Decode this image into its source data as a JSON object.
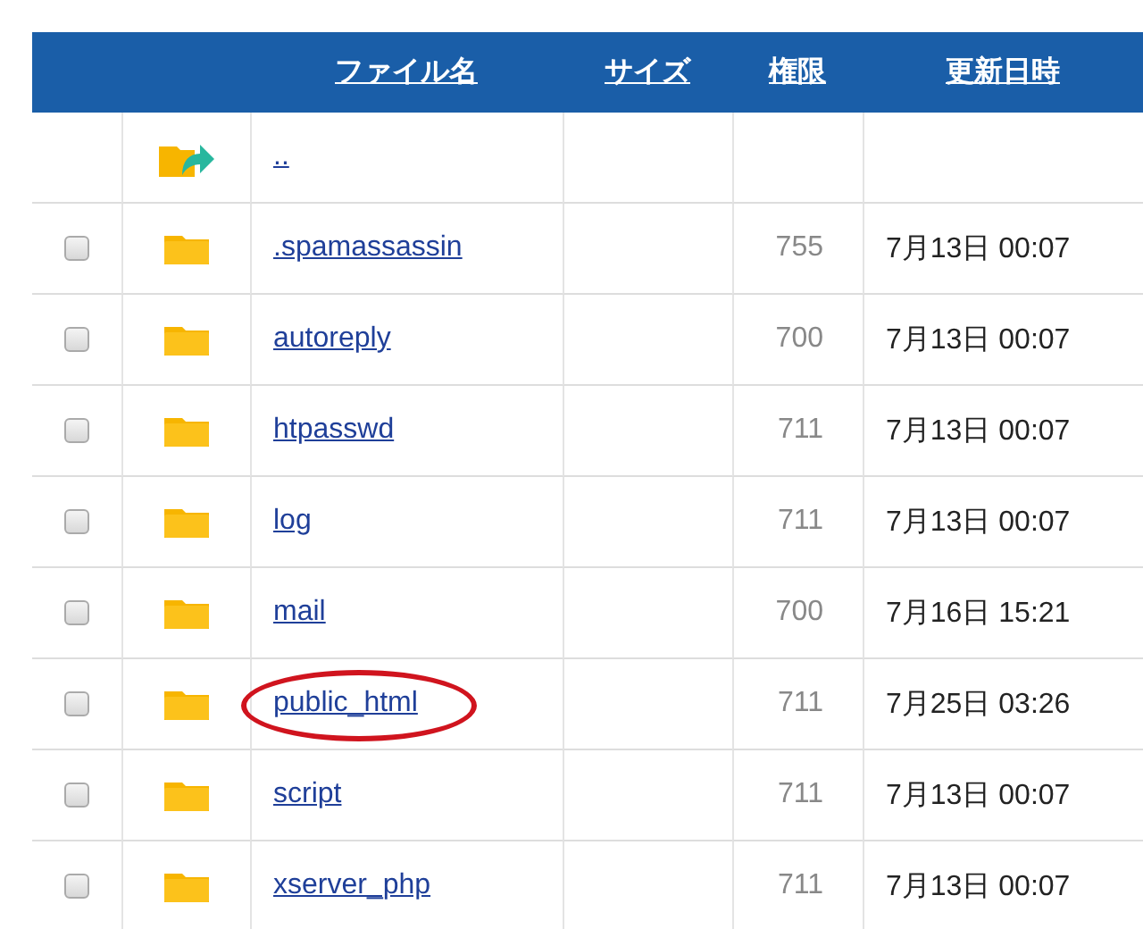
{
  "table": {
    "columns": [
      {
        "label": "ファイル名"
      },
      {
        "label": "サイズ"
      },
      {
        "label": "権限"
      },
      {
        "label": "更新日時"
      }
    ],
    "rows": [
      {
        "kind": "parent",
        "name": ".."
      },
      {
        "kind": "folder",
        "name": ".spamassassin",
        "permission": "755",
        "modified": "7月13日 00:07",
        "checked": false,
        "circled": false
      },
      {
        "kind": "folder",
        "name": "autoreply",
        "permission": "700",
        "modified": "7月13日 00:07",
        "checked": false,
        "circled": false
      },
      {
        "kind": "folder",
        "name": "htpasswd",
        "permission": "711",
        "modified": "7月13日 00:07",
        "checked": false,
        "circled": false
      },
      {
        "kind": "folder",
        "name": "log",
        "permission": "711",
        "modified": "7月13日 00:07",
        "checked": false,
        "circled": false
      },
      {
        "kind": "folder",
        "name": "mail",
        "permission": "700",
        "modified": "7月16日 15:21",
        "checked": false,
        "circled": false
      },
      {
        "kind": "folder",
        "name": "public_html",
        "permission": "711",
        "modified": "7月25日 03:26",
        "checked": false,
        "circled": true
      },
      {
        "kind": "folder",
        "name": "script",
        "permission": "711",
        "modified": "7月13日 00:07",
        "checked": false,
        "circled": false
      },
      {
        "kind": "folder",
        "name": "xserver_php",
        "permission": "711",
        "modified": "7月13日 00:07",
        "checked": false,
        "circled": false
      }
    ]
  }
}
